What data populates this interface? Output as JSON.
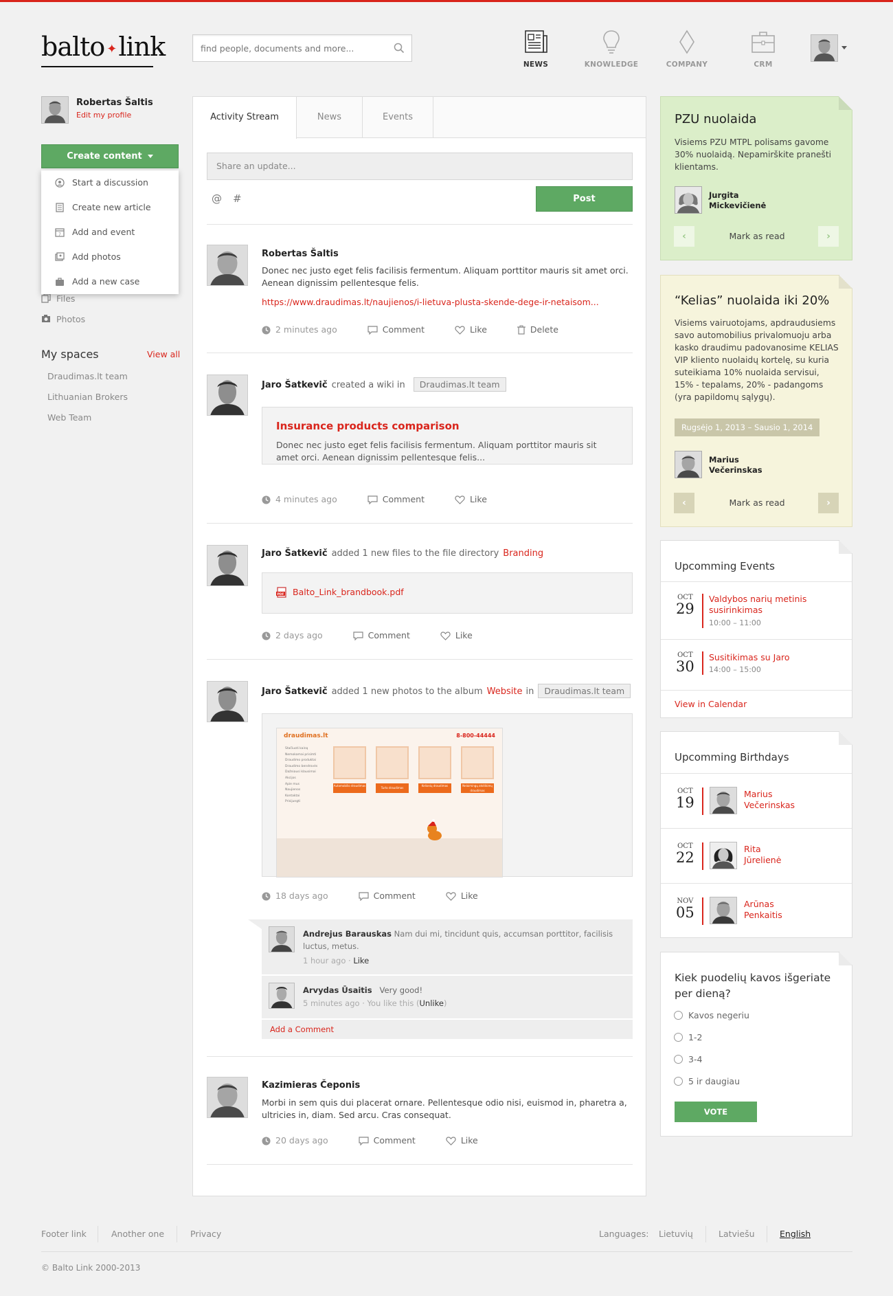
{
  "header": {
    "logo_left": "balto",
    "logo_right": "link",
    "search_placeholder": "find people, documents and more...",
    "nav": [
      {
        "label": "NEWS",
        "icon": "newspaper-icon"
      },
      {
        "label": "KNOWLEDGE",
        "icon": "lightbulb-icon"
      },
      {
        "label": "COMPANY",
        "icon": "diamond-icon"
      },
      {
        "label": "CRM",
        "icon": "briefcase-icon"
      }
    ]
  },
  "sidebar": {
    "user_name": "Robertas Šaltis",
    "edit_profile": "Edit my profile",
    "create_button": "Create content",
    "create_menu": [
      {
        "label": "Start a discussion",
        "icon": "discussion-icon"
      },
      {
        "label": "Create new article",
        "icon": "article-icon"
      },
      {
        "label": "Add and event",
        "icon": "calendar-icon"
      },
      {
        "label": "Add photos",
        "icon": "photos-icon"
      },
      {
        "label": "Add a new case",
        "icon": "case-icon"
      }
    ],
    "links": {
      "files": "Files",
      "photos": "Photos"
    },
    "spaces_title": "My spaces",
    "spaces_view_all": "View all",
    "spaces": [
      "Draudimas.lt team",
      "Lithuanian Brokers",
      "Web Team"
    ]
  },
  "main": {
    "tabs": [
      "Activity Stream",
      "News",
      "Events"
    ],
    "share_placeholder": "Share an update...",
    "at_symbol": "@",
    "hash_symbol": "#",
    "post_button": "Post",
    "actions": {
      "comment": "Comment",
      "like": "Like",
      "delete": "Delete"
    },
    "posts": [
      {
        "author": "Robertas Šaltis",
        "text": "Donec nec justo eget felis facilisis fermentum. Aliquam porttitor mauris sit amet orci. Aenean dignissim pellentesque felis.",
        "link": "https://www.draudimas.lt/naujienos/i-lietuva-plusta-skende-dege-ir-netaisom...",
        "time": "2 minutes ago"
      },
      {
        "author": "Jaro Šatkevič",
        "action": "created a wiki in",
        "tag": "Draudimas.lt team",
        "wiki_title": "Insurance products comparison",
        "wiki_text": "Donec nec justo eget felis facilisis fermentum. Aliquam porttitor mauris sit amet orci. Aenean dignissim pellentesque felis...",
        "time": "4 minutes ago"
      },
      {
        "author": "Jaro Šatkevič",
        "action": "added 1 new files to the file directory",
        "target": "Branding",
        "file": "Balto_Link_brandbook.pdf",
        "time": "2 days ago"
      },
      {
        "author": "Jaro Šatkevič",
        "action": "added 1 new photos to the album",
        "target": "Website",
        "action2": "in",
        "tag": "Draudimas.lt team",
        "time": "18 days ago",
        "shot": {
          "brand": "draudimas.lt",
          "phone": "8-800-44444",
          "menu": [
            "Stačiuoti kainą",
            "Nemokamai prisimti",
            "Draudimo produktai",
            "Draudimo bendrovės",
            "Dažniausi klausimai",
            "Akcijos",
            "Apie mus",
            "Naujienos",
            "Kontaktai",
            "Prisijungti"
          ],
          "tiles": [
            "Automobilio draudimas",
            "Turto draudimas",
            "Kelionių draudimas",
            "Nelaimingų atsitikimų draudimas"
          ]
        },
        "comments": [
          {
            "author": "Andrejus Barauskas",
            "text": "Nam dui mi, tincidunt quis, accumsan porttitor, facilisis luctus, metus.",
            "time": "1 hour ago ·",
            "action": "Like"
          },
          {
            "author": "Arvydas Ūsaitis",
            "text": "Very good!",
            "time": "5 minutes ago · You like this (",
            "action": "Unlike",
            "close": ")"
          }
        ],
        "add_comment": "Add a Comment"
      },
      {
        "author": "Kazimieras Čeponis",
        "text": "Morbi in sem quis dui placerat ornare. Pellentesque odio nisi, euismod in, pharetra a, ultricies in, diam. Sed arcu. Cras consequat.",
        "time": "20 days ago"
      }
    ]
  },
  "right": {
    "notice1": {
      "title": "PZU nuolaida",
      "text": "Visiems PZU MTPL polisams gavome 30% nuolaidą. Nepamirškite pranešti klientams.",
      "author_first": "Jurgita",
      "author_last": "Mickevičienė",
      "mark": "Mark as read",
      "prev": "‹",
      "next": "›"
    },
    "notice2": {
      "title": "“Kelias” nuolaida iki 20%",
      "text": "Visiems vairuotojams, apdraudusiems savo automobilius privalomuoju arba kasko draudimu padovanosime KELIAS VIP kliento nuolaidų kortelę, su kuria suteikiama 10% nuolaida servisui, 15% - tepalams, 20% - padangoms (yra papildomų sąlygų).",
      "dates": "Rugsėjo 1, 2013 – Sausio 1, 2014",
      "author_first": "Marius",
      "author_last": "Večerinskas",
      "mark": "Mark as read",
      "prev": "‹",
      "next": "›"
    },
    "events": {
      "title": "Upcomming Events",
      "items": [
        {
          "month": "OCT",
          "day": "29",
          "title": "Valdybos narių metinis susirinkimas",
          "time": "10:00 – 11:00"
        },
        {
          "month": "OCT",
          "day": "30",
          "title": "Susitikimas su Jaro",
          "time": "14:00 – 15:00"
        }
      ],
      "calendar_link": "View in Calendar"
    },
    "birthdays": {
      "title": "Upcomming Birthdays",
      "items": [
        {
          "month": "OCT",
          "day": "19",
          "first": "Marius",
          "last": "Večerinskas"
        },
        {
          "month": "OCT",
          "day": "22",
          "first": "Rita",
          "last": "Jūrelienė"
        },
        {
          "month": "NOV",
          "day": "05",
          "first": "Arūnas",
          "last": "Penkaitis"
        }
      ]
    },
    "poll": {
      "question": "Kiek puodelių kavos išgeriate per dieną?",
      "options": [
        "Kavos negeriu",
        "1-2",
        "3-4",
        "5 ir daugiau"
      ],
      "vote": "VOTE"
    }
  },
  "footer": {
    "links": [
      "Footer link",
      "Another one",
      "Privacy"
    ],
    "languages_label": "Languages:",
    "languages": [
      "Lietuvių",
      "Latviešu",
      "English"
    ],
    "copyright": "© Balto Link 2000-2013"
  },
  "colors": {
    "accent": "#d9251c",
    "green": "#5ea963",
    "notice_green": "#dbeec9",
    "notice_yellow": "#f6f4dc"
  }
}
